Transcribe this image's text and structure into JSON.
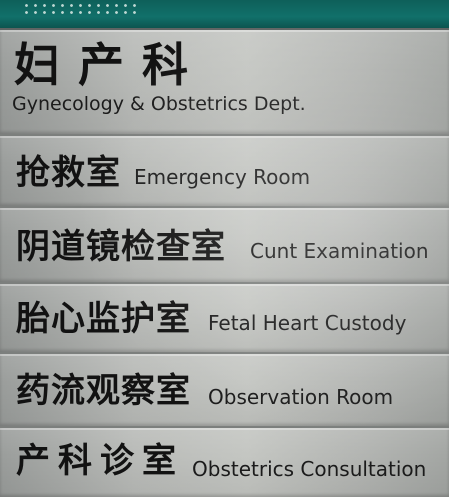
{
  "sign": {
    "title": {
      "chinese": "妇产科",
      "english": "Gynecology & Obstetrics Dept."
    },
    "rooms": [
      {
        "chinese": "抢救室",
        "english": "Emergency Room"
      },
      {
        "chinese": "阴道镜检查室",
        "english": "Cunt Examination"
      },
      {
        "chinese": "胎心监护室",
        "english": "Fetal Heart Custody"
      },
      {
        "chinese": "药流观察室",
        "english": "Observation Room"
      },
      {
        "chinese": "产科诊室",
        "english": "Obstetrics Consultation"
      }
    ]
  },
  "colors": {
    "top_strip": "#11706a",
    "panel": "#b9bbb8",
    "text": "#121212"
  }
}
